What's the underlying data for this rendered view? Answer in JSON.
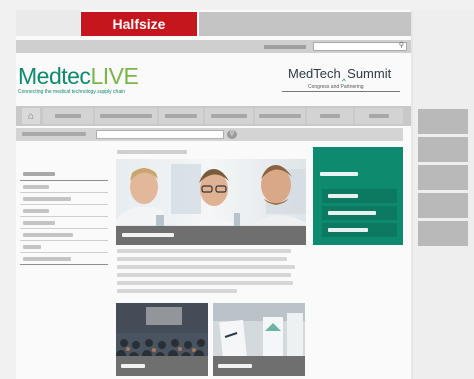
{
  "banner": {
    "halfsize_label": "Halfsize",
    "accent_color": "#c4161c"
  },
  "logos": {
    "medteclive": {
      "part1": "Medtec",
      "part2": "LIVE",
      "tagline": "Connecting the medical technology supply chain"
    },
    "summit": {
      "name1": "MedTech",
      "name2": "Summit",
      "tagline": "Congress and Partnering"
    }
  },
  "colors": {
    "teal": "#0e8a6e",
    "green": "#7ab648"
  },
  "icons": {
    "top_search": "search-icon",
    "home": "home-icon",
    "sub_search": "search-icon"
  }
}
